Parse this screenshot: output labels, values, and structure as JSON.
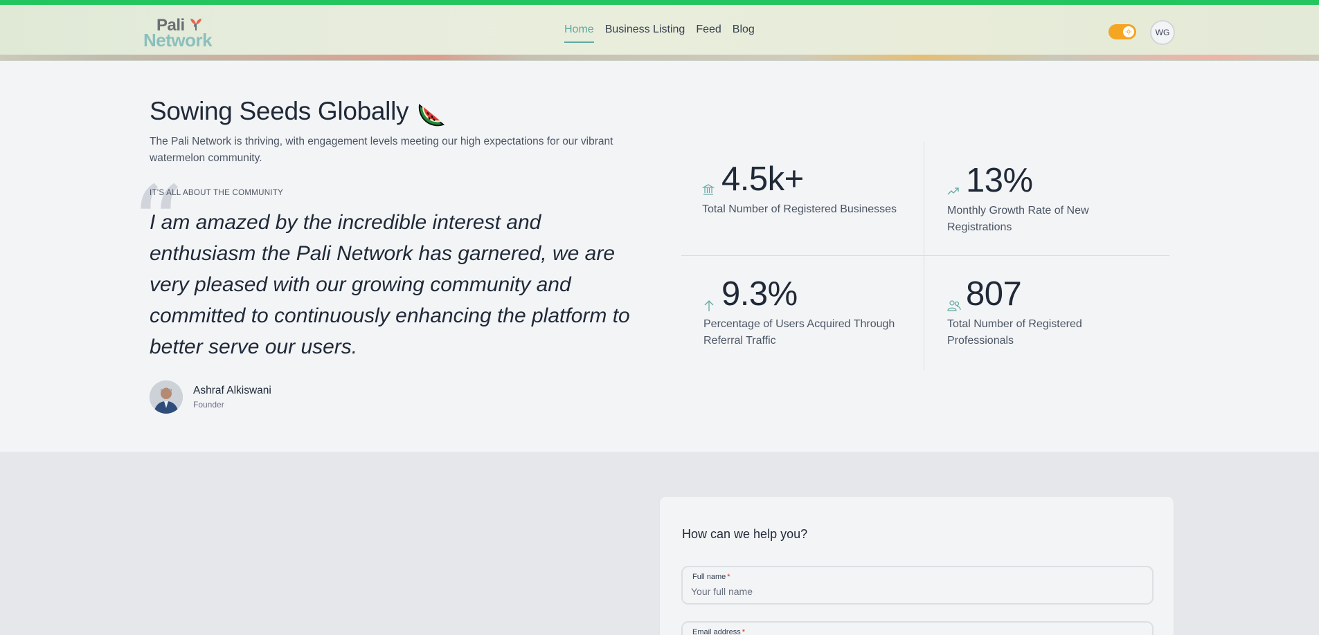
{
  "header": {
    "logo_line1": "Pali",
    "logo_line2": "Network",
    "nav": [
      {
        "label": "Home",
        "active": true
      },
      {
        "label": "Business Listing",
        "active": false
      },
      {
        "label": "Feed",
        "active": false
      },
      {
        "label": "Blog",
        "active": false
      }
    ],
    "theme_toggle_icon": "sun-icon",
    "user_initials": "WG"
  },
  "colors": {
    "top_bar": "#22c55e",
    "accent": "#5fa8a0",
    "toggle": "#f4a521"
  },
  "hero": {
    "title": "Sowing Seeds Globally",
    "title_icon": "watermelon-icon",
    "intro": "The Pali Network is thriving, with engagement levels meeting our high expectations for our vibrant watermelon community.",
    "eyebrow": "IT'S ALL ABOUT THE COMMUNITY",
    "quote": "I am amazed by the incredible interest and enthusiasm the Pali Network has garnered, we are very pleased with our growing community and committed to continuously enhancing the platform to better serve our users.",
    "person_name": "Ashraf Alkiswani",
    "person_role": "Founder"
  },
  "stats": [
    {
      "value": "4.5k+",
      "label": "Total Number of Registered Businesses",
      "icon": "bank-icon"
    },
    {
      "value": "13%",
      "label": "Monthly Growth Rate of New Registrations",
      "icon": "trending-up-icon"
    },
    {
      "value": "9.3%",
      "label": "Percentage of Users Acquired Through Referral Traffic",
      "icon": "arrow-up-icon"
    },
    {
      "value": "807",
      "label": "Total Number of Registered Professionals",
      "icon": "users-icon"
    }
  ],
  "contact": {
    "title": "How can we help you?",
    "full_name_label": "Full name",
    "full_name_placeholder": "Your full name",
    "email_label": "Email address",
    "required_mark": "*"
  }
}
